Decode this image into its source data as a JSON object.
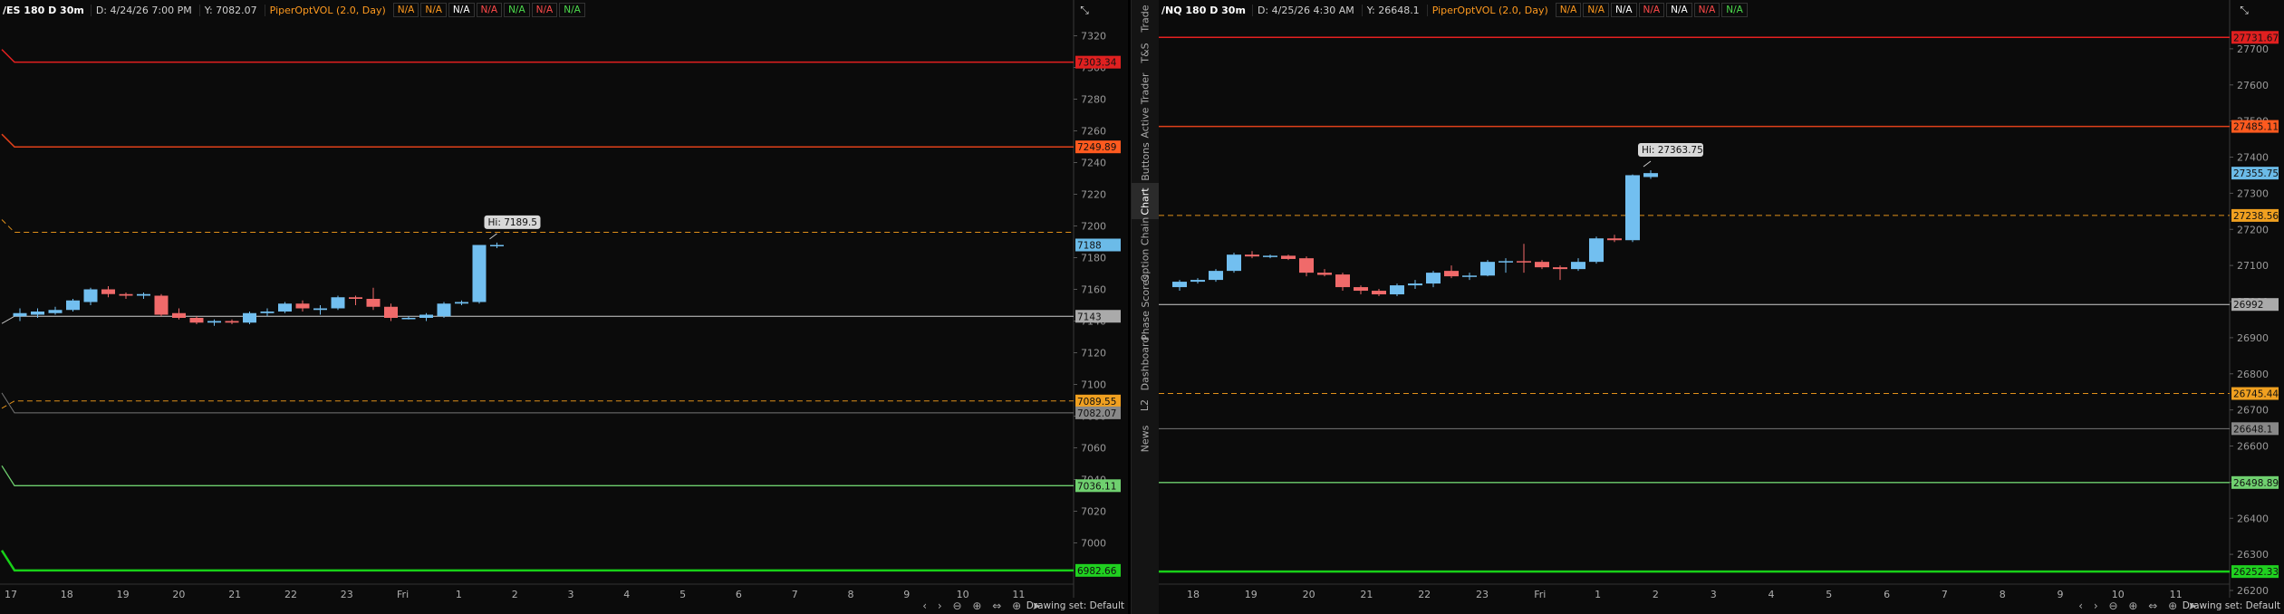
{
  "left_chart": {
    "symbol": "/ES 180 D 30m",
    "date_label": "D: 4/24/26 7:00 PM",
    "y_label": "Y: 7082.07",
    "study": "PiperOptVOL (2.0, Day)",
    "na_badges": [
      {
        "text": "N/A",
        "color": "#ff9a1f"
      },
      {
        "text": "N/A",
        "color": "#ff9a1f"
      },
      {
        "text": "N/A",
        "color": "#ffffff"
      },
      {
        "text": "N/A",
        "color": "#ff4a4a"
      },
      {
        "text": "N/A",
        "color": "#4cd94c"
      },
      {
        "text": "N/A",
        "color": "#ff4a4a"
      },
      {
        "text": "N/A",
        "color": "#4cd94c"
      }
    ],
    "price_ticks": [
      "7320",
      "7300",
      "7280",
      "7260",
      "7240",
      "7220",
      "7200",
      "7180",
      "7160",
      "7140",
      "7120",
      "7100",
      "7080",
      "7060",
      "7040",
      "7020",
      "7000"
    ],
    "x_ticks": [
      "17",
      "18",
      "19",
      "20",
      "21",
      "22",
      "23",
      "Fri",
      "1",
      "2",
      "3",
      "4",
      "5",
      "6",
      "7",
      "8",
      "9",
      "10",
      "11"
    ],
    "hi_label": "Hi: 7189.5",
    "price_badges": [
      {
        "text": "7303.34",
        "color": "#e02020"
      },
      {
        "text": "7249.89",
        "color": "#ff5a1f"
      },
      {
        "text": "7188",
        "color": "#6bbbe8"
      },
      {
        "text": "7143",
        "color": "#aaaaaa"
      },
      {
        "text": "7089.55",
        "color": "#f0a020"
      },
      {
        "text": "7082.07",
        "color": "#888888"
      },
      {
        "text": "7036.11",
        "color": "#6fd06f"
      },
      {
        "text": "6982.66",
        "color": "#20d020"
      }
    ],
    "drawing_set": "Drawing set: Default"
  },
  "right_chart": {
    "symbol": "/NQ 180 D 30m",
    "date_label": "D: 4/25/26 4:30 AM",
    "y_label": "Y: 26648.1",
    "study": "PiperOptVOL (2.0, Day)",
    "na_badges": [
      {
        "text": "N/A",
        "color": "#ff9a1f"
      },
      {
        "text": "N/A",
        "color": "#ff9a1f"
      },
      {
        "text": "N/A",
        "color": "#ffffff"
      },
      {
        "text": "N/A",
        "color": "#ff4a4a"
      },
      {
        "text": "N/A",
        "color": "#ffffff"
      },
      {
        "text": "N/A",
        "color": "#ff4a4a"
      },
      {
        "text": "N/A",
        "color": "#4cd94c"
      }
    ],
    "price_ticks": [
      "27700",
      "27600",
      "27500",
      "27400",
      "27300",
      "27200",
      "27100",
      "27000",
      "26900",
      "26800",
      "26700",
      "26600",
      "26500",
      "26400",
      "26300",
      "26200"
    ],
    "x_ticks": [
      "18",
      "19",
      "20",
      "21",
      "22",
      "23",
      "Fri",
      "1",
      "2",
      "3",
      "4",
      "5",
      "6",
      "7",
      "8",
      "9",
      "10",
      "11"
    ],
    "hi_label": "Hi: 27363.75",
    "price_badges": [
      {
        "text": "27731.67",
        "color": "#e02020"
      },
      {
        "text": "27485.11",
        "color": "#ff5a1f"
      },
      {
        "text": "27355.75",
        "color": "#6bbbe8"
      },
      {
        "text": "27238.56",
        "color": "#f0a020"
      },
      {
        "text": "26992",
        "color": "#aaaaaa"
      },
      {
        "text": "26745.44",
        "color": "#f0a020"
      },
      {
        "text": "26648.1",
        "color": "#888888"
      },
      {
        "text": "26498.89",
        "color": "#6fd06f"
      },
      {
        "text": "26252.33",
        "color": "#20d020"
      }
    ],
    "drawing_set": "Drawing set: Default"
  },
  "side_tabs": [
    "Trade",
    "T&S",
    "Active Trader",
    "Buttons",
    "Chart",
    "Option Chain",
    "Phase Scores",
    "Dashboard",
    "L2",
    "News"
  ],
  "active_side_tab": "Chart",
  "chart_data": [
    {
      "type": "candlestick",
      "title": "/ES 180 D 30m",
      "x": [
        "17",
        "18",
        "19",
        "20",
        "21",
        "22",
        "23",
        "Fri",
        "1",
        "2",
        "3",
        "4",
        "5",
        "6",
        "7"
      ],
      "ylim": [
        6970,
        7330
      ],
      "candles": [
        {
          "o": 7143,
          "h": 7148,
          "l": 7140,
          "c": 7145
        },
        {
          "o": 7144,
          "h": 7148,
          "l": 7142,
          "c": 7146
        },
        {
          "o": 7145,
          "h": 7149,
          "l": 7144,
          "c": 7147
        },
        {
          "o": 7147,
          "h": 7154,
          "l": 7146,
          "c": 7153
        },
        {
          "o": 7152,
          "h": 7161,
          "l": 7150,
          "c": 7160
        },
        {
          "o": 7160,
          "h": 7162,
          "l": 7155,
          "c": 7157
        },
        {
          "o": 7157,
          "h": 7158,
          "l": 7154,
          "c": 7156
        },
        {
          "o": 7156,
          "h": 7158,
          "l": 7154,
          "c": 7157
        },
        {
          "o": 7156,
          "h": 7157,
          "l": 7143,
          "c": 7144
        },
        {
          "o": 7145,
          "h": 7148,
          "l": 7141,
          "c": 7142
        },
        {
          "o": 7142,
          "h": 7143,
          "l": 7138,
          "c": 7139
        },
        {
          "o": 7139,
          "h": 7141,
          "l": 7137,
          "c": 7140
        },
        {
          "o": 7140,
          "h": 7141,
          "l": 7138,
          "c": 7139
        },
        {
          "o": 7139,
          "h": 7146,
          "l": 7138,
          "c": 7145
        },
        {
          "o": 7145,
          "h": 7148,
          "l": 7143,
          "c": 7146
        },
        {
          "o": 7146,
          "h": 7152,
          "l": 7145,
          "c": 7151
        },
        {
          "o": 7151,
          "h": 7153,
          "l": 7146,
          "c": 7148
        },
        {
          "o": 7147,
          "h": 7150,
          "l": 7144,
          "c": 7148
        },
        {
          "o": 7148,
          "h": 7156,
          "l": 7147,
          "c": 7155
        },
        {
          "o": 7155,
          "h": 7156,
          "l": 7150,
          "c": 7154
        },
        {
          "o": 7154,
          "h": 7161,
          "l": 7147,
          "c": 7149
        },
        {
          "o": 7149,
          "h": 7151,
          "l": 7140,
          "c": 7142
        },
        {
          "o": 7142,
          "h": 7143,
          "l": 7141,
          "c": 7142
        },
        {
          "o": 7142,
          "h": 7145,
          "l": 7140,
          "c": 7144
        },
        {
          "o": 7143,
          "h": 7152,
          "l": 7142,
          "c": 7151
        },
        {
          "o": 7151,
          "h": 7153,
          "l": 7150,
          "c": 7152
        },
        {
          "o": 7152,
          "h": 7188,
          "l": 7151,
          "c": 7188
        },
        {
          "o": 7188,
          "h": 7189.5,
          "l": 7186,
          "c": 7188
        }
      ],
      "levels": [
        7303.34,
        7249.89,
        7196,
        7143,
        7089.55,
        7082.07,
        7036.11,
        6982.66
      ]
    },
    {
      "type": "candlestick",
      "title": "/NQ 180 D 30m",
      "x": [
        "18",
        "19",
        "20",
        "21",
        "22",
        "23",
        "Fri",
        "1",
        "2",
        "3",
        "4",
        "5",
        "6",
        "7"
      ],
      "ylim": [
        26200,
        27780
      ],
      "candles": [
        {
          "o": 27040,
          "h": 27060,
          "l": 27030,
          "c": 27055
        },
        {
          "o": 27055,
          "h": 27065,
          "l": 27050,
          "c": 27060
        },
        {
          "o": 27060,
          "h": 27090,
          "l": 27055,
          "c": 27085
        },
        {
          "o": 27085,
          "h": 27135,
          "l": 27080,
          "c": 27130
        },
        {
          "o": 27130,
          "h": 27140,
          "l": 27120,
          "c": 27125
        },
        {
          "o": 27125,
          "h": 27130,
          "l": 27120,
          "c": 27127
        },
        {
          "o": 27127,
          "h": 27130,
          "l": 27115,
          "c": 27118
        },
        {
          "o": 27120,
          "h": 27125,
          "l": 27070,
          "c": 27080
        },
        {
          "o": 27080,
          "h": 27090,
          "l": 27070,
          "c": 27074
        },
        {
          "o": 27075,
          "h": 27080,
          "l": 27030,
          "c": 27040
        },
        {
          "o": 27040,
          "h": 27045,
          "l": 27020,
          "c": 27030
        },
        {
          "o": 27030,
          "h": 27035,
          "l": 27015,
          "c": 27020
        },
        {
          "o": 27020,
          "h": 27050,
          "l": 27015,
          "c": 27045
        },
        {
          "o": 27045,
          "h": 27060,
          "l": 27035,
          "c": 27050
        },
        {
          "o": 27050,
          "h": 27085,
          "l": 27040,
          "c": 27080
        },
        {
          "o": 27085,
          "h": 27100,
          "l": 27065,
          "c": 27070
        },
        {
          "o": 27070,
          "h": 27080,
          "l": 27060,
          "c": 27072
        },
        {
          "o": 27072,
          "h": 27115,
          "l": 27070,
          "c": 27110
        },
        {
          "o": 27110,
          "h": 27120,
          "l": 27080,
          "c": 27112
        },
        {
          "o": 27112,
          "h": 27160,
          "l": 27080,
          "c": 27110
        },
        {
          "o": 27110,
          "h": 27115,
          "l": 27090,
          "c": 27095
        },
        {
          "o": 27095,
          "h": 27100,
          "l": 27060,
          "c": 27090
        },
        {
          "o": 27090,
          "h": 27120,
          "l": 27085,
          "c": 27110
        },
        {
          "o": 27110,
          "h": 27180,
          "l": 27105,
          "c": 27175
        },
        {
          "o": 27175,
          "h": 27185,
          "l": 27165,
          "c": 27170
        },
        {
          "o": 27170,
          "h": 27352,
          "l": 27165,
          "c": 27350
        },
        {
          "o": 27345,
          "h": 27363.75,
          "l": 27340,
          "c": 27355.75
        }
      ],
      "levels": [
        27731.67,
        27485.11,
        27238.56,
        26992,
        26745.44,
        26648.1,
        26498.89,
        26252.33
      ]
    }
  ]
}
